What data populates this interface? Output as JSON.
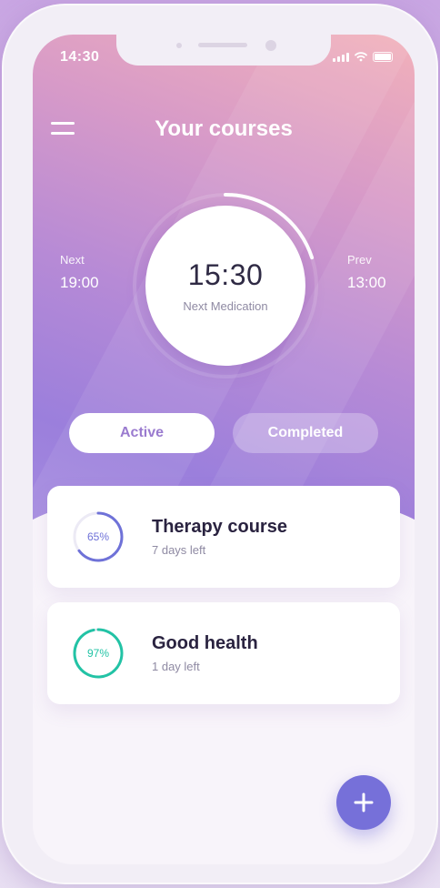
{
  "status_bar": {
    "time": "14:30"
  },
  "header": {
    "title": "Your courses"
  },
  "schedule": {
    "next_label": "Next",
    "next_time": "19:00",
    "prev_label": "Prev",
    "prev_time": "13:00",
    "current_time": "15:30",
    "current_label": "Next Medication",
    "progress": 0.2
  },
  "tabs": [
    {
      "label": "Active",
      "selected": true
    },
    {
      "label": "Completed",
      "selected": false
    }
  ],
  "courses": [
    {
      "title": "Therapy course",
      "subtitle": "7 days left",
      "percent_label": "65%",
      "progress": 0.65,
      "color": "#6f72d8"
    },
    {
      "title": "Good health",
      "subtitle": "1 day left",
      "percent_label": "97%",
      "progress": 0.97,
      "color": "#22c3a5"
    }
  ],
  "colors": {
    "accent": "#7670d9",
    "active_tab_text": "#9a7bcf"
  },
  "icons": {
    "menu": "hamburger-menu-icon",
    "add": "plus-icon",
    "signal": "signal-icon",
    "wifi": "wifi-icon",
    "battery": "battery-icon"
  }
}
